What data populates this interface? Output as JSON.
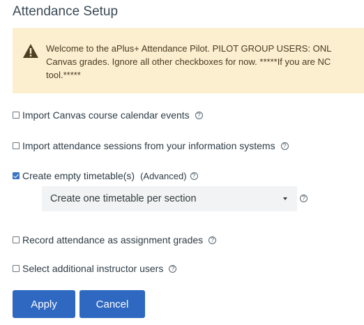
{
  "page": {
    "title": "Attendance Setup"
  },
  "warning": {
    "icon": "warning-triangle-icon",
    "line1": "Welcome to the aPlus+ Attendance Pilot. PILOT GROUP USERS: ONL",
    "line2": "Canvas grades. Ignore all other checkboxes for now. *****If you are NC",
    "line3": "tool.*****"
  },
  "options": {
    "import_calendar": {
      "label": "Import Canvas course calendar events",
      "checked": false
    },
    "import_sessions": {
      "label": "Import attendance sessions from your information systems",
      "checked": false
    },
    "create_timetable": {
      "label": "Create empty timetable(s)",
      "tag": "(Advanced)",
      "checked": true
    },
    "record_grades": {
      "label": "Record attendance as assignment grades",
      "checked": false
    },
    "select_instructors": {
      "label": "Select additional instructor users",
      "checked": false
    }
  },
  "timetable_select": {
    "value": "Create one timetable per section"
  },
  "help_glyph": "?",
  "buttons": {
    "apply": "Apply",
    "cancel": "Cancel"
  },
  "colors": {
    "primary": "#2f68c0",
    "warning_bg": "#fcefd0",
    "warning_icon": "#5a4a2a"
  }
}
